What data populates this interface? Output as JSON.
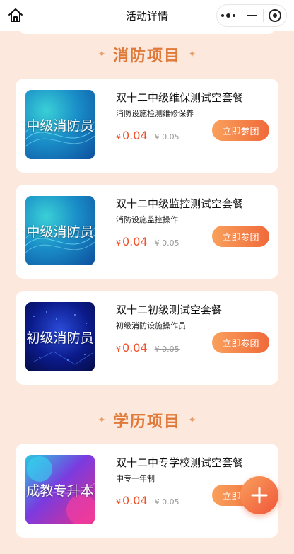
{
  "nav": {
    "title": "活动详情",
    "home_icon": "home-icon",
    "more_icon": "more-dots-icon",
    "minimize_icon": "minimize-icon",
    "close_icon": "target-close-icon"
  },
  "sections": [
    {
      "title": "消防项目",
      "decoration": "✦"
    },
    {
      "title": "学历项目",
      "decoration": "✦"
    }
  ],
  "cards": [
    {
      "thumb_text": "中级消防员",
      "title": "双十二中级维保测试空套餐",
      "subtitle": "消防设施检测维修保养",
      "currency": "¥",
      "price": "0.04",
      "old_price": "¥ 0.05",
      "button": "立即参团"
    },
    {
      "thumb_text": "中级消防员",
      "title": "双十二中级监控测试空套餐",
      "subtitle": "消防设施监控操作",
      "currency": "¥",
      "price": "0.04",
      "old_price": "¥ 0.05",
      "button": "立即参团"
    },
    {
      "thumb_text": "初级消防员",
      "title": "双十二初级测试空套餐",
      "subtitle": "初级消防设施操作员",
      "currency": "¥",
      "price": "0.04",
      "old_price": "¥ 0.05",
      "button": "立即参团"
    },
    {
      "thumb_text": "成教专升本",
      "title": "双十二中专学校测试空套餐",
      "subtitle": "中专一年制",
      "currency": "¥",
      "price": "0.04",
      "old_price": "¥ 0.05",
      "button": "立即参团"
    }
  ],
  "fab": {
    "icon": "plus-icon"
  },
  "colors": {
    "page_bg": "#fde8dd",
    "section_title": "#e07a3a",
    "price": "#f2502a",
    "button_start": "#f9a05c",
    "button_end": "#f06a3a"
  }
}
